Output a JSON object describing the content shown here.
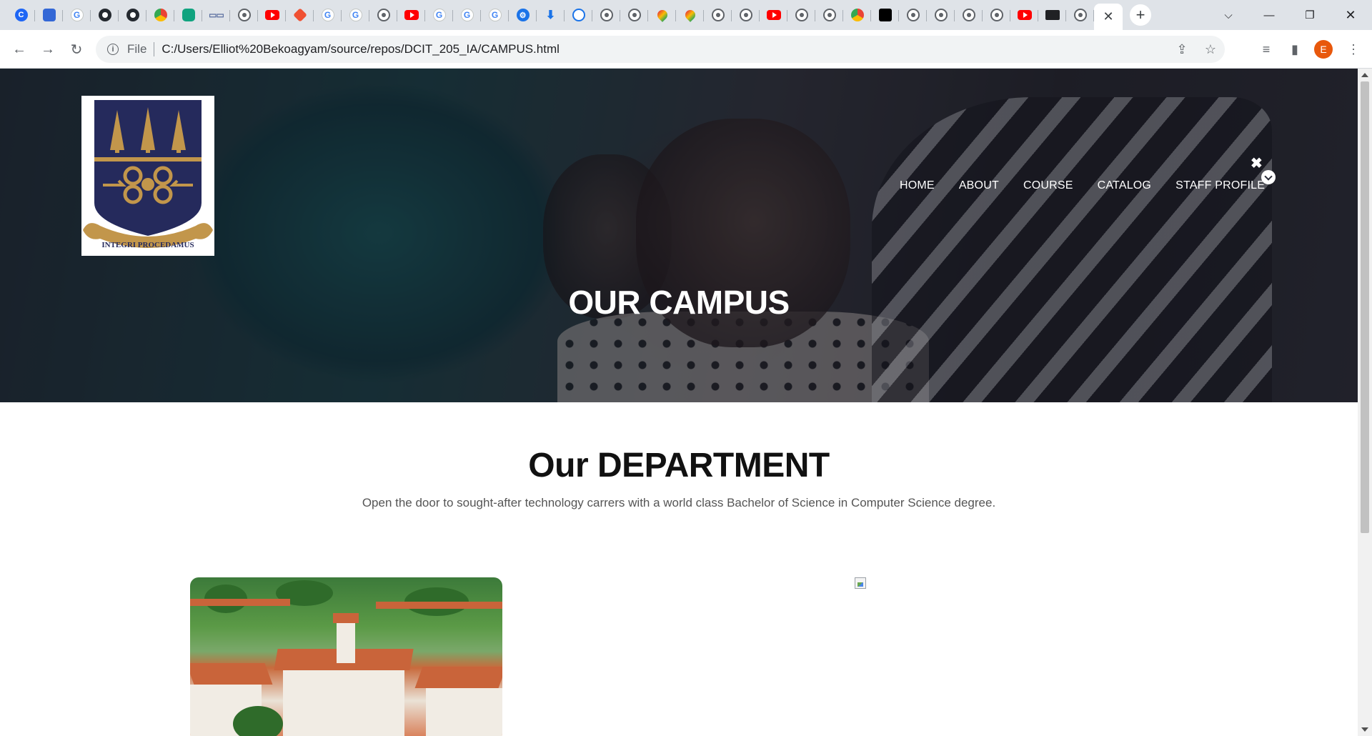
{
  "browser": {
    "tabs": [
      {
        "icon": "ovr"
      },
      {
        "icon": "prn"
      },
      {
        "icon": "g"
      },
      {
        "icon": "gh"
      },
      {
        "icon": "gh"
      },
      {
        "icon": "chrome"
      },
      {
        "icon": "gpt"
      },
      {
        "icon": "dots"
      },
      {
        "icon": "globe"
      },
      {
        "icon": "yt"
      },
      {
        "icon": "git"
      },
      {
        "icon": "g"
      },
      {
        "icon": "g"
      },
      {
        "icon": "globe"
      },
      {
        "icon": "yt"
      },
      {
        "icon": "g"
      },
      {
        "icon": "g"
      },
      {
        "icon": "g"
      },
      {
        "icon": "set"
      },
      {
        "icon": "dl"
      },
      {
        "icon": "hist"
      },
      {
        "icon": "globe"
      },
      {
        "icon": "globe"
      },
      {
        "icon": "map"
      },
      {
        "icon": "map"
      },
      {
        "icon": "globe"
      },
      {
        "icon": "globe"
      },
      {
        "icon": "yt"
      },
      {
        "icon": "globe"
      },
      {
        "icon": "globe"
      },
      {
        "icon": "chrome"
      },
      {
        "icon": "blk"
      },
      {
        "icon": "globe"
      },
      {
        "icon": "globe"
      },
      {
        "icon": "globe"
      },
      {
        "icon": "globe"
      },
      {
        "icon": "yt"
      },
      {
        "icon": "mg"
      },
      {
        "icon": "globe"
      }
    ],
    "address": {
      "scheme_label": "File",
      "url": "C:/Users/Elliot%20Bekoagyam/source/repos/DCIT_205_IA/CAMPUS.html"
    },
    "profile_initial": "E",
    "profile_color": "#e8580c"
  },
  "page": {
    "logo": {
      "motto": "INTEGRI PROCEDAMUS",
      "shield_color": "#252a5c",
      "gold_color": "#c2964b"
    },
    "nav": {
      "items": [
        "HOME",
        "ABOUT",
        "COURSE",
        "CATALOG",
        "STAFF PROFILE"
      ],
      "close_glyph": "✖"
    },
    "hero_title": "OUR CAMPUS",
    "department": {
      "title": "Our DEPARTMENT",
      "subtitle": "Open the door to sought-after technology carrers with a world class Bachelor of Science in Computer Science degree."
    }
  }
}
